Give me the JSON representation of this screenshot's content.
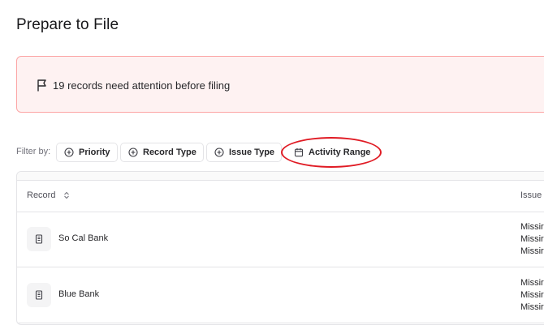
{
  "page": {
    "title": "Prepare to File"
  },
  "alert": {
    "message": "19 records need attention before filing",
    "icon": "flag-icon",
    "bg_color": "#fef2f2",
    "border_color": "#fca5a5"
  },
  "filters": {
    "label": "Filter by:",
    "chips": [
      {
        "label": "Priority",
        "icon": "plus-circle-icon"
      },
      {
        "label": "Record Type",
        "icon": "plus-circle-icon"
      },
      {
        "label": "Issue Type",
        "icon": "plus-circle-icon"
      },
      {
        "label": "Activity Range",
        "icon": "calendar-icon",
        "highlighted": true
      }
    ]
  },
  "highlight": {
    "color": "#e01b24"
  },
  "table": {
    "columns": [
      {
        "label": "Record",
        "sortable": true
      },
      {
        "label": "Issue"
      }
    ],
    "rows": [
      {
        "name": "So Cal Bank",
        "icon": "bank-icon",
        "issues": [
          "Missir",
          "Missir",
          "Missir"
        ]
      },
      {
        "name": "Blue Bank",
        "icon": "bank-icon",
        "issues": [
          "Missir",
          "Missir",
          "Missir"
        ]
      }
    ]
  }
}
